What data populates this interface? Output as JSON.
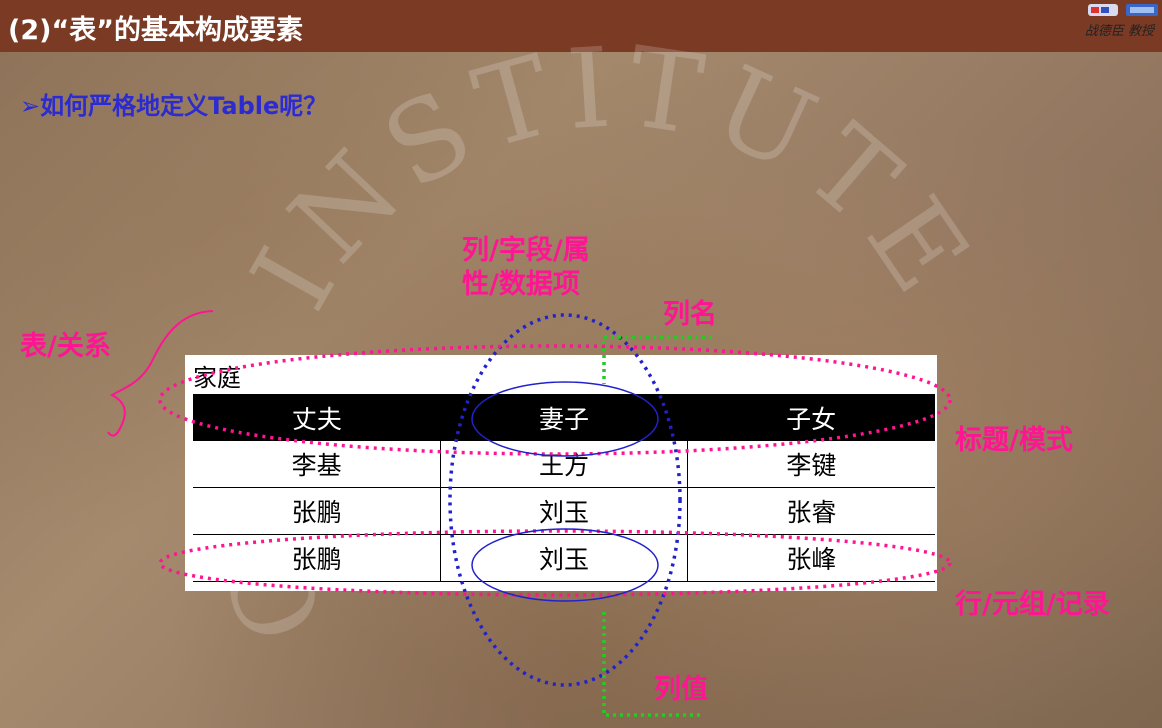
{
  "header": {
    "title": "(2)“表”的基本构成要素",
    "author": "战德臣 教授"
  },
  "question": "➢如何严格地定义Table呢？",
  "watermark": "CES INSTITUTE",
  "table": {
    "caption": "家庭",
    "columns": [
      "丈夫",
      "妻子",
      "子女"
    ],
    "rows": [
      [
        "李基",
        "王方",
        "李键"
      ],
      [
        "张鹏",
        "刘玉",
        "张睿"
      ],
      [
        "张鹏",
        "刘玉",
        "张峰"
      ]
    ]
  },
  "labels": {
    "column_attr_line1": "列/字段/属",
    "column_attr_line2": "性/数据项",
    "column_name": "列名",
    "table_relation": "表/关系",
    "header_schema": "标题/模式",
    "row_tuple": "行/元组/记录",
    "column_value": "列值"
  },
  "colors": {
    "header_bg": "#7b3a24",
    "question_blue": "#2b2bd1",
    "annotation_pink": "#ff1493",
    "ellipse_blue": "#2222cc",
    "bracket_green": "#22cc22"
  }
}
